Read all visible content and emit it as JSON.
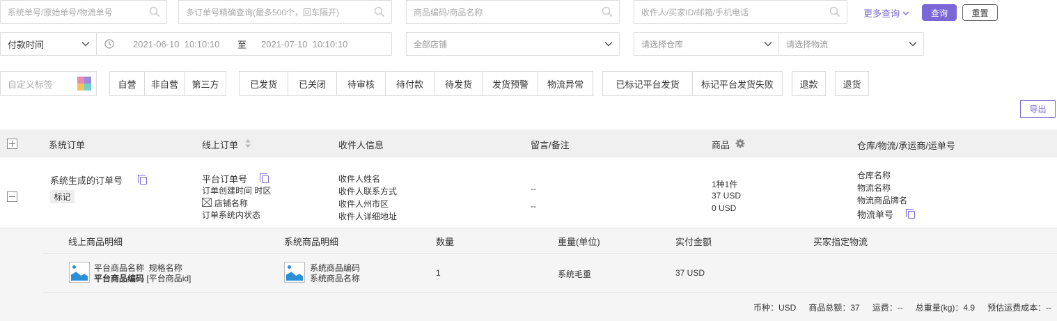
{
  "filters": {
    "order_no_placeholder": "系统单号/原始单号/物流单号",
    "multi_order_placeholder": "多订单号精确查询(最多500个，回车隔开)",
    "product_placeholder": "商品编码/商品名称",
    "recipient_placeholder": "收件人/买家ID/邮箱/手机电话",
    "more_query": "更多查询",
    "query_btn": "查询",
    "reset_btn": "重置",
    "time_type": "付款时间",
    "date_from": "2021-06-10  10:10:10",
    "date_sep": "至",
    "date_to": "2021-07-10  10:10:10",
    "shop": "全部店铺",
    "warehouse": "请选择仓库",
    "logistics": "请选择物流",
    "tag_placeholder": "自定义标签"
  },
  "groups": {
    "ownership": [
      "自营",
      "非自营",
      "第三方"
    ],
    "status": [
      "已发货",
      "已关闭",
      "待审核",
      "待付款",
      "待发货",
      "发货预警",
      "物流异常"
    ],
    "platform": [
      "已标记平台发货",
      "标记平台发货失败"
    ],
    "refund": "退款",
    "return": "退货"
  },
  "export_btn": "导出",
  "table": {
    "headers": {
      "system_order": "系统订单",
      "online_order": "线上订单",
      "recipient": "收件人信息",
      "remark": "留言/备注",
      "product": "商品",
      "warehouse": "仓库/物流/承运商/运单号"
    },
    "row": {
      "system_order_no": "系统生成的订单号",
      "tag": "标记",
      "platform_order_no": "平台订单号",
      "created_time": "订单创建时间 时区",
      "shop_name": "店铺名称",
      "system_status": "订单系统内状态",
      "recipient_name": "收件人姓名",
      "recipient_contact": "收件人联系方式",
      "recipient_region": "收件人州市区",
      "recipient_address": "收件人详细地址",
      "message": "--",
      "note": "--",
      "product_summary": "1种1件",
      "product_amount": "37 USD",
      "product_extra": "0 USD",
      "warehouse_name": "仓库名称",
      "logistics_name": "物流名称",
      "logistics_brand": "物流商品牌名",
      "tracking_no": "物流单号"
    }
  },
  "detail": {
    "headers": {
      "online_item": "线上商品明细",
      "system_item": "系统商品明细",
      "qty": "数量",
      "weight": "重量(单位)",
      "paid": "实付金额",
      "buyer_logistics": "买家指定物流"
    },
    "item": {
      "platform_name": "平台商品名称",
      "spec_name": "规格名称",
      "platform_code": "平台商品编码",
      "platform_id": "[平台商品id]",
      "sys_code": "系统商品编码",
      "sys_name": "系统商品名称",
      "qty": "1",
      "weight": "系统毛重",
      "paid": "37 USD"
    },
    "summary": {
      "currency": "币种：USD",
      "total": "商品总额：37",
      "shipping": "运费：--",
      "total_weight": "总重量(kg)：4.9",
      "est_cost": "预估运费成本：--"
    }
  },
  "colors": {
    "accent": "#7b68d6",
    "header_bg": "#f0f0f0",
    "detail_bg": "#f5f5f5"
  }
}
